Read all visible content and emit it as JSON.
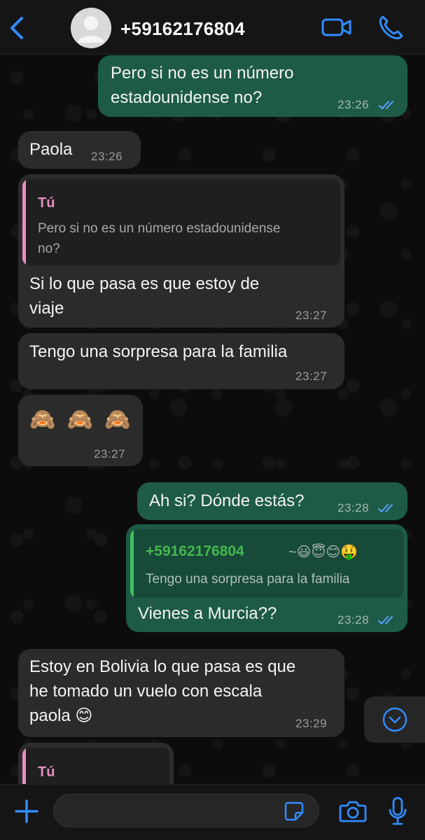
{
  "header": {
    "contact_name": "+59162176804",
    "icons": {
      "back": "chevron-left-icon",
      "avatar": "person-avatar",
      "video": "video-call-icon",
      "call": "phone-icon"
    },
    "accent_color": "#2f8cff"
  },
  "messages": [
    {
      "id": "m1",
      "direction": "out",
      "text": "Pero si no es un número\nestadounidense no?",
      "time": "23:26",
      "status": "read"
    },
    {
      "id": "m2",
      "direction": "in",
      "text": "Paola",
      "time": "23:26"
    },
    {
      "id": "m3",
      "direction": "in",
      "quote": {
        "author": "Tú",
        "text": "Pero si no es un número estadounidense\nno?"
      },
      "text": "Si lo que pasa es que estoy de\nviaje",
      "time": "23:27"
    },
    {
      "id": "m4",
      "direction": "in",
      "text": "Tengo una sorpresa para la familia",
      "time": "23:27"
    },
    {
      "id": "m5",
      "direction": "in",
      "text": "🙈 🙈 🙈",
      "time": "23:27"
    },
    {
      "id": "m6",
      "direction": "out",
      "text": "Ah si? Dónde estás?",
      "time": "23:28",
      "status": "read"
    },
    {
      "id": "m7",
      "direction": "out",
      "quote": {
        "author": "+59162176804",
        "author_suffix": "~😃😇😊🤑",
        "text": "Tengo una sorpresa para la familia"
      },
      "text": "Vienes a Murcia??",
      "time": "23:28",
      "status": "read"
    },
    {
      "id": "m8",
      "direction": "in",
      "text": "Estoy en Bolivia lo que pasa es que\nhe tomado un vuelo con escala\npaola 😊",
      "time": "23:29"
    },
    {
      "id": "m9",
      "direction": "in",
      "quote": {
        "author": "Tú"
      }
    }
  ],
  "colors": {
    "outgoing_bubble": "#1d5b47",
    "incoming_bubble": "#2b2b2b",
    "quote_you_bar": "#e58fc0",
    "quote_contact_bar": "#3fc25a",
    "quote_contact_name": "#44b84f",
    "read_ticks": "#5aa2ff"
  },
  "footer": {
    "input_value": "",
    "icons": {
      "attach": "plus-icon",
      "sticker": "sticker-icon",
      "camera": "camera-icon",
      "mic": "microphone-icon"
    }
  },
  "scroll_button": {
    "icon": "chevron-down-circle-icon"
  }
}
